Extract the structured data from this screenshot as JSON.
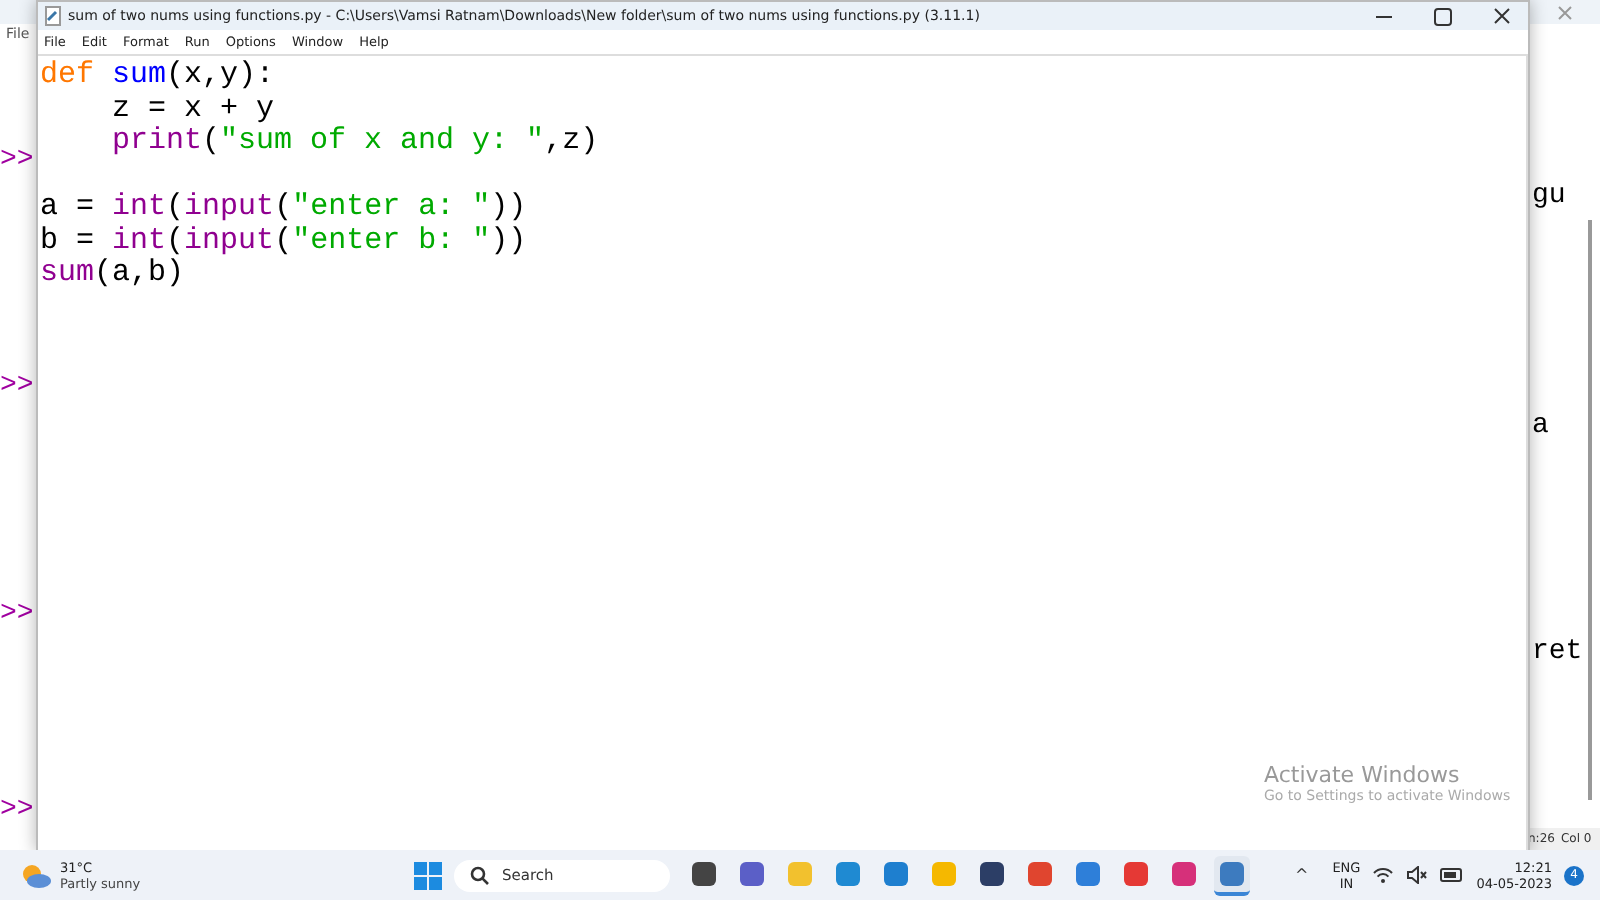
{
  "background_window": {
    "menu": [
      "File"
    ],
    "prompts": [
      ">>",
      ">>",
      ">>",
      ">>"
    ],
    "right_fragments": [
      "gu",
      "a",
      "ret"
    ],
    "status": [
      "n:26",
      "Col 0"
    ]
  },
  "editor": {
    "title": "sum of two nums using functions.py - C:\\Users\\Vamsi Ratnam\\Downloads\\New folder\\sum of two nums using functions.py (3.11.1)",
    "menu": [
      "File",
      "Edit",
      "Format",
      "Run",
      "Options",
      "Window",
      "Help"
    ],
    "lines": [
      {
        "tokens": [
          {
            "kind": "keyword",
            "text": "def"
          },
          {
            "kind": "defname",
            "text": " sum"
          },
          {
            "kind": "plain",
            "text": "(x,y):"
          }
        ]
      },
      {
        "tokens": [
          {
            "kind": "plain",
            "text": "    z = x + y"
          }
        ]
      },
      {
        "tokens": [
          {
            "kind": "builtin",
            "text": "    print"
          },
          {
            "kind": "plain",
            "text": "("
          },
          {
            "kind": "string",
            "text": "\"sum of x and y: \""
          },
          {
            "kind": "plain",
            "text": ",z)"
          }
        ]
      },
      {
        "blank_before": true,
        "tokens": [
          {
            "kind": "plain",
            "text": "a = "
          },
          {
            "kind": "builtin",
            "text": "int"
          },
          {
            "kind": "plain",
            "text": "("
          },
          {
            "kind": "builtin",
            "text": "input"
          },
          {
            "kind": "plain",
            "text": "("
          },
          {
            "kind": "string",
            "text": "\"enter a: \""
          },
          {
            "kind": "plain",
            "text": "))"
          }
        ]
      },
      {
        "tokens": [
          {
            "kind": "plain",
            "text": "b = "
          },
          {
            "kind": "builtin",
            "text": "int"
          },
          {
            "kind": "plain",
            "text": "("
          },
          {
            "kind": "builtin",
            "text": "input"
          },
          {
            "kind": "plain",
            "text": "("
          },
          {
            "kind": "string",
            "text": "\"enter b: \""
          },
          {
            "kind": "plain",
            "text": "))"
          }
        ]
      },
      {
        "tokens": [
          {
            "kind": "builtin",
            "text": "sum"
          },
          {
            "kind": "plain",
            "text": "(a,b)"
          }
        ]
      }
    ]
  },
  "watermark": {
    "title": "Activate Windows",
    "subtitle": "Go to Settings to activate Windows"
  },
  "taskbar": {
    "weather": {
      "temp": "31°C",
      "desc": "Partly sunny"
    },
    "search": {
      "placeholder": "Search"
    },
    "apps": [
      {
        "color": "#444444",
        "selected": false
      },
      {
        "color": "#5b5fc7",
        "selected": false
      },
      {
        "color": "#f2c12e",
        "selected": false
      },
      {
        "color": "#1f8ad2",
        "selected": false
      },
      {
        "color": "#1e7fcf",
        "selected": false
      },
      {
        "color": "#f5b800",
        "selected": false
      },
      {
        "color": "#2c3e66",
        "selected": false
      },
      {
        "color": "#e0452f",
        "selected": false
      },
      {
        "color": "#2e7fd9",
        "selected": false
      },
      {
        "color": "#e53935",
        "selected": false
      },
      {
        "color": "#d6307a",
        "selected": false
      },
      {
        "color": "#3d7bbf",
        "selected": true
      }
    ],
    "tray": {
      "chevron": "^",
      "lang": "ENG",
      "region": "IN",
      "time": "12:21",
      "date": "04-05-2023",
      "badge": "4"
    }
  }
}
